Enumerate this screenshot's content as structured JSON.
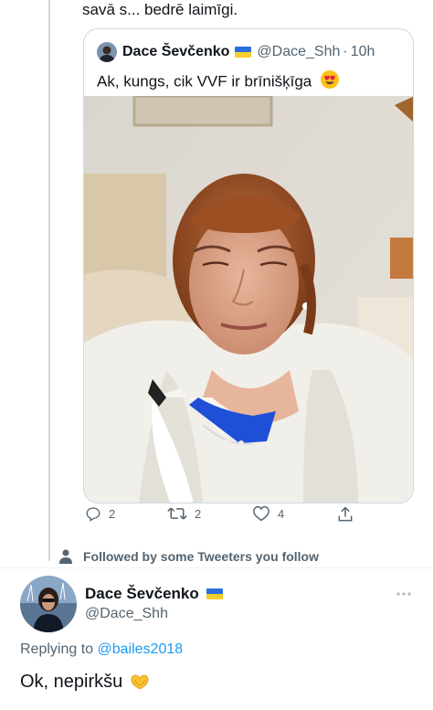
{
  "top_text": "savā s... bedrē laimīgi.",
  "quote": {
    "author_name": "Dace Ševčenko",
    "author_handle": "@Dace_Shh",
    "separator": "·",
    "time": "10h",
    "text": "Ak, kungs, cik VVF ir brīnišķīga",
    "emoji": "smiling-face-with-heart-eyes",
    "flag_colors": [
      "#2b6fdc",
      "#f5cd2e"
    ]
  },
  "actions": {
    "reply_count": "2",
    "retweet_count": "2",
    "like_count": "4"
  },
  "social_context": "Followed by some Tweeters you follow",
  "author": {
    "name": "Dace Ševčenko",
    "handle": "@Dace_Shh"
  },
  "replying": {
    "prefix": "Replying to",
    "handle": "@bailes2018"
  },
  "reply_text": "Ok, nepirkšu",
  "colors": {
    "link": "#1d9bf0",
    "secondary": "#536471",
    "border": "#cfd9de"
  }
}
